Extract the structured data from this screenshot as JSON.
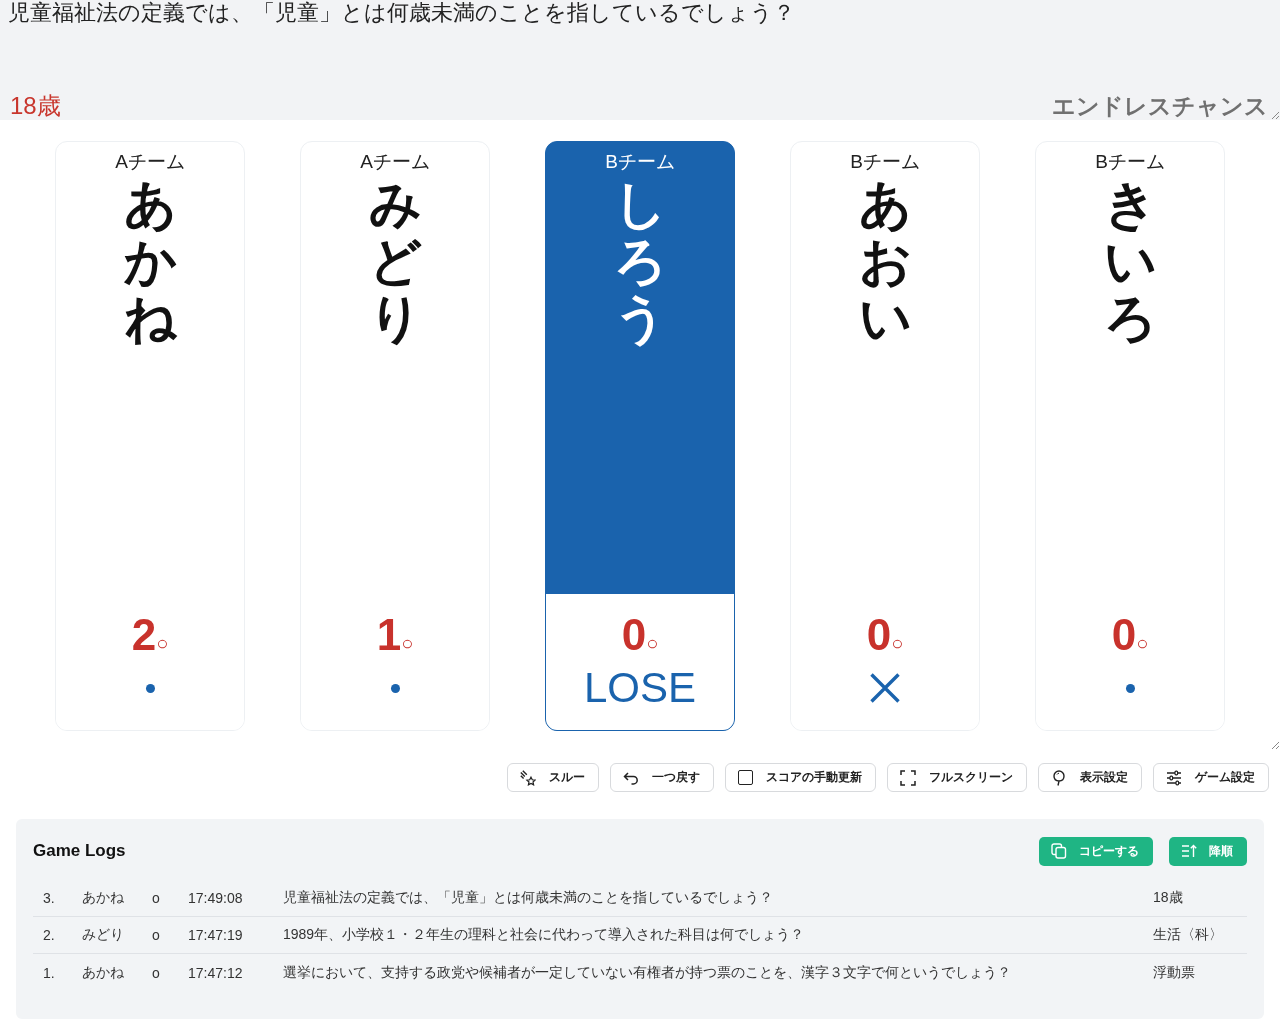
{
  "question": {
    "text": "児童福祉法の定義では、「児童」とは何歳未満のことを指しているでしょう？",
    "answer": "18歳",
    "mode": "エンドレスチャンス"
  },
  "cards": [
    {
      "team": "Aチーム",
      "name": "あかね",
      "score": "2",
      "score_mark": "○",
      "status": {
        "kind": "dot"
      },
      "selected": false
    },
    {
      "team": "Aチーム",
      "name": "みどり",
      "score": "1",
      "score_mark": "○",
      "status": {
        "kind": "dot"
      },
      "selected": false
    },
    {
      "team": "Bチーム",
      "name": "しろう",
      "score": "0",
      "score_mark": "○",
      "status": {
        "kind": "label",
        "text": "LOSE"
      },
      "selected": true
    },
    {
      "team": "Bチーム",
      "name": "あおい",
      "score": "0",
      "score_mark": "○",
      "status": {
        "kind": "cross"
      },
      "selected": false
    },
    {
      "team": "Bチーム",
      "name": "きいろ",
      "score": "0",
      "score_mark": "○",
      "status": {
        "kind": "dot"
      },
      "selected": false
    }
  ],
  "toolbar": [
    {
      "kind": "button",
      "label": "スルー"
    },
    {
      "kind": "button",
      "label": "一つ戻す"
    },
    {
      "kind": "checkbox",
      "label": "スコアの手動更新",
      "checked": false
    },
    {
      "kind": "button",
      "label": "フルスクリーン"
    },
    {
      "kind": "button",
      "label": "表示設定"
    },
    {
      "kind": "button",
      "label": "ゲーム設定"
    }
  ],
  "game_logs": {
    "title": "Game Logs",
    "buttons": [
      "コピーする",
      "降順"
    ],
    "rows": [
      {
        "number": "3.",
        "player": "あかね",
        "mark": "o",
        "time": "17:49:08",
        "question": "児童福祉法の定義では、「児童」とは何歳未満のことを指しているでしょう？",
        "answer": "18歳"
      },
      {
        "number": "2.",
        "player": "みどり",
        "mark": "o",
        "time": "17:47:19",
        "question": "1989年、小学校１・２年生の理科と社会に代わって導入された科目は何でしょう？",
        "answer": "生活〈科〉"
      },
      {
        "number": "1.",
        "player": "あかね",
        "mark": "o",
        "time": "17:47:12",
        "question": "選挙において、支持する政党や候補者が一定していない有権者が持つ票のことを、漢字３文字で何というでしょう？",
        "answer": "浮動票"
      }
    ]
  }
}
